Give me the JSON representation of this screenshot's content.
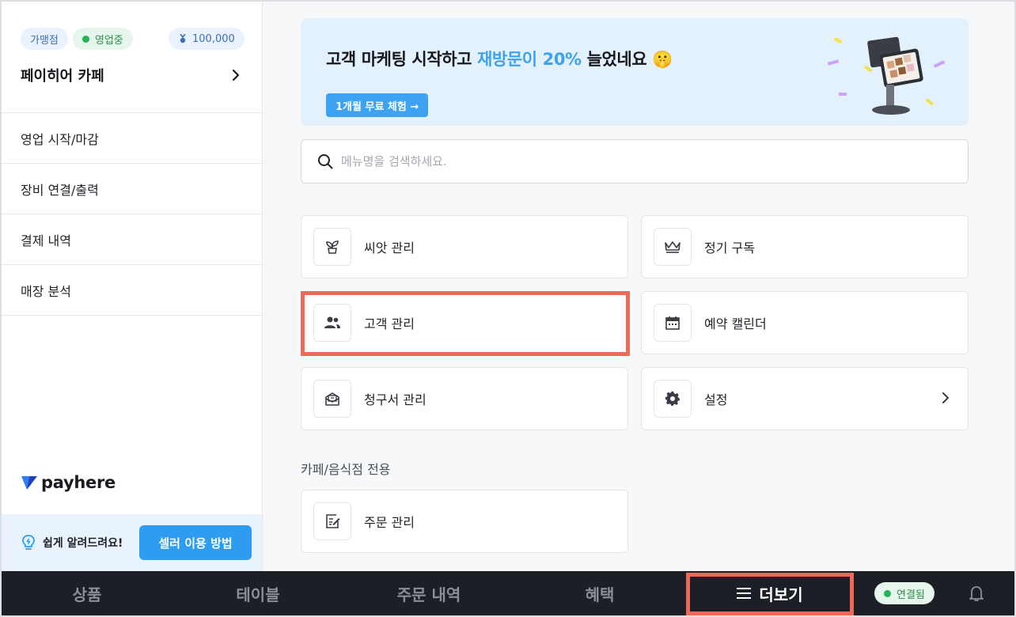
{
  "sidebar": {
    "badges": {
      "franchise": "가맹점",
      "status": "영업중",
      "points": "100,000"
    },
    "store_name": "페이히어 카페",
    "menu": [
      {
        "label": "영업 시작/마감"
      },
      {
        "label": "장비 연결/출력"
      },
      {
        "label": "결제 내역"
      },
      {
        "label": "매장 분석"
      }
    ],
    "brand": "payhere",
    "help_text": "쉽게 알려드려요!",
    "help_button": "셀러 이용 방법"
  },
  "banner": {
    "title_prefix": "고객 마케팅 시작하고 ",
    "title_highlight": "재방문이 20%",
    "title_suffix": " 늘었네요 ",
    "emoji": "🤫",
    "cta": "1개월 무료 체험 →"
  },
  "search": {
    "placeholder": "메뉴명을 검색하세요.",
    "value": ""
  },
  "cards": [
    {
      "label": "씨앗 관리",
      "icon": "sprout-icon"
    },
    {
      "label": "정기 구독",
      "icon": "crown-icon"
    },
    {
      "label": "고객 관리",
      "icon": "users-icon"
    },
    {
      "label": "예약 캘린더",
      "icon": "calendar-icon"
    },
    {
      "label": "청구서 관리",
      "icon": "invoice-icon"
    },
    {
      "label": "설정",
      "icon": "gear-icon"
    }
  ],
  "section_cafe": {
    "title": "카페/음식점 전용",
    "cards": [
      {
        "label": "주문 관리",
        "icon": "order-edit-icon"
      }
    ]
  },
  "bottom_nav": {
    "items": [
      {
        "label": "상품"
      },
      {
        "label": "테이블"
      },
      {
        "label": "주문 내역"
      },
      {
        "label": "혜택"
      },
      {
        "label": "더보기"
      }
    ],
    "connection": "연결됨"
  },
  "colors": {
    "accent": "#2e9cf0",
    "highlight_outline": "#ee6a57",
    "nav_bg": "#1c1f26",
    "status_green": "#22b457"
  }
}
